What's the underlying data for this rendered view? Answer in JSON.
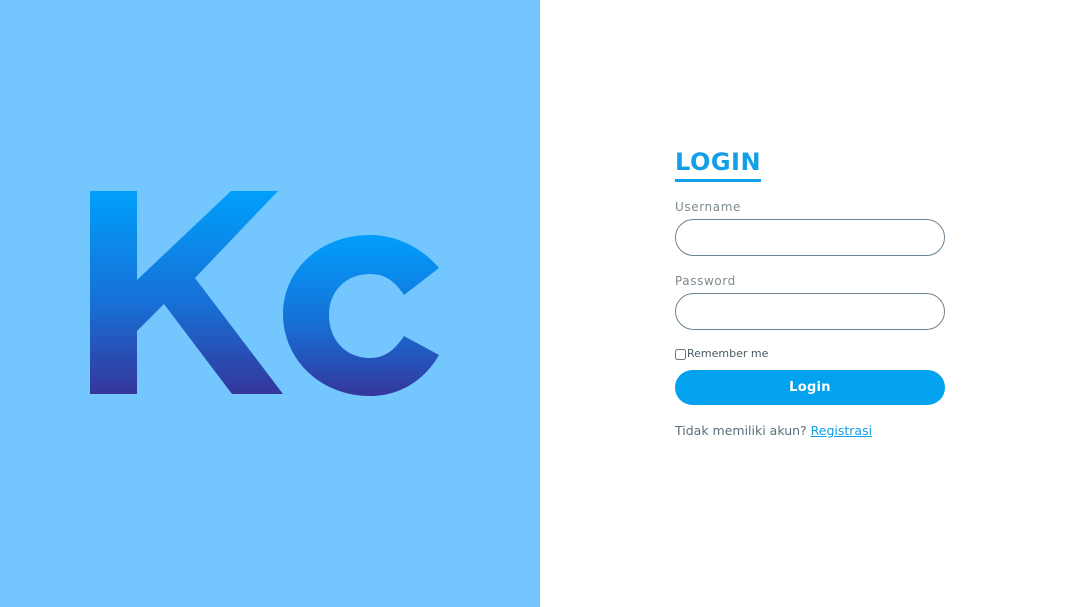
{
  "brand": {
    "logo_text": "Kc",
    "background_color": "#73c6fe",
    "gradient_top": "#009ffb",
    "gradient_bottom": "#34369b"
  },
  "login": {
    "title": "LOGIN",
    "username_label": "Username",
    "username_value": "",
    "password_label": "Password",
    "password_value": "",
    "remember_label": "Remember me",
    "remember_checked": false,
    "button_label": "Login",
    "no_account_text": "Tidak memiliki akun?",
    "register_link": "Registrasi",
    "accent_color": "#02a2ee"
  }
}
